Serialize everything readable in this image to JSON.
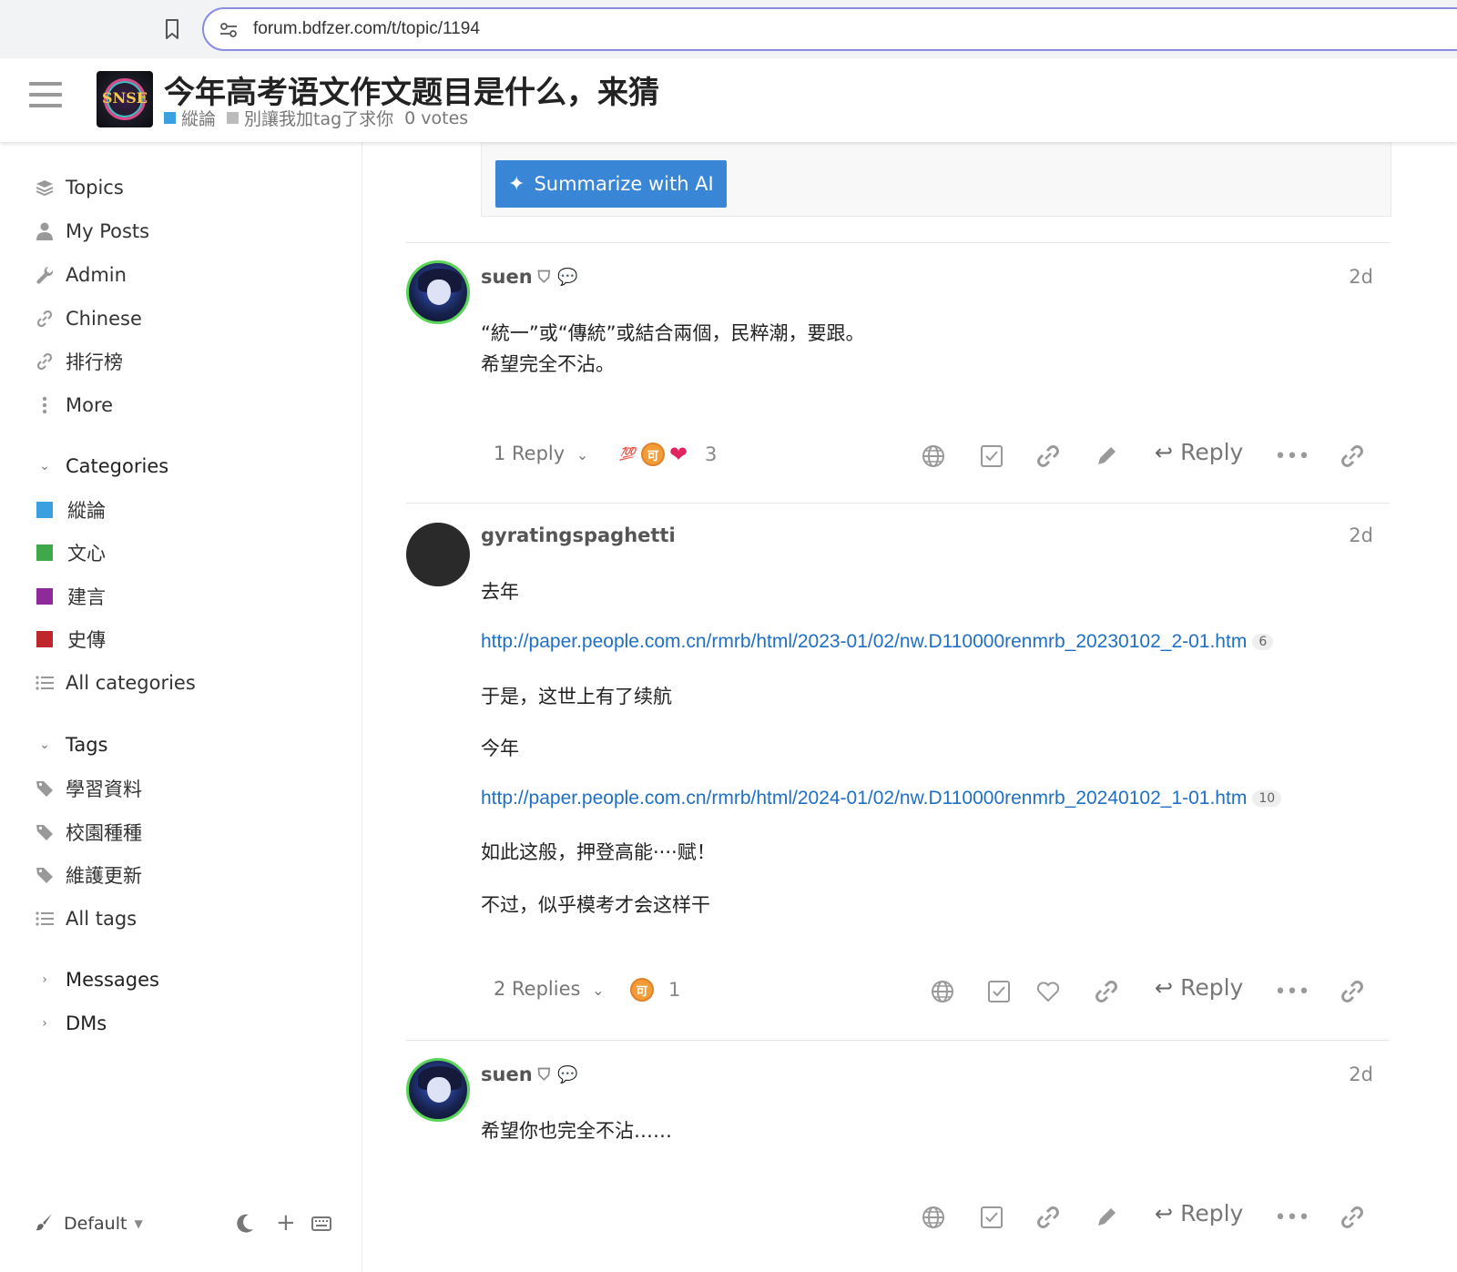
{
  "browser": {
    "url": "forum.bdfzer.com/t/topic/1194",
    "bookmark_icon": "bookmark-icon",
    "site_settings_icon": "tune-icon"
  },
  "header": {
    "logo_text": "SNSE",
    "title": "今年高考语文作文题目是什么，来猜",
    "category": "縱論",
    "category_color": "#3ba0e0",
    "tag": "別讓我加tag了求你",
    "votes": "0 votes"
  },
  "sidebar": {
    "nav": [
      {
        "label": "Topics",
        "icon": "layers-icon"
      },
      {
        "label": "My Posts",
        "icon": "user-icon"
      },
      {
        "label": "Admin",
        "icon": "wrench-icon"
      },
      {
        "label": "Chinese",
        "icon": "link-icon"
      },
      {
        "label": "排行榜",
        "icon": "link-icon"
      },
      {
        "label": "More",
        "icon": "ellipsis-vertical-icon"
      }
    ],
    "categories_title": "Categories",
    "categories": [
      {
        "label": "縱論",
        "color": "#3ba0e0"
      },
      {
        "label": "文心",
        "color": "#3fa84a"
      },
      {
        "label": "建言",
        "color": "#8e2a9a"
      },
      {
        "label": "史傳",
        "color": "#c0272d"
      }
    ],
    "all_categories": "All categories",
    "tags_title": "Tags",
    "tags": [
      "學習資料",
      "校園種種",
      "維護更新"
    ],
    "all_tags": "All tags",
    "messages": "Messages",
    "dms": "DMs",
    "footer": {
      "theme_label": "Default"
    }
  },
  "summary": {
    "button_label": "Summarize with AI"
  },
  "posts": [
    {
      "username": "suen",
      "date": "2d",
      "lines": [
        "“統一”或“傳統”或結合兩個，民粹潮，要跟。",
        "希望完全不沾。"
      ],
      "replies": "1 Reply",
      "reaction_count": "3",
      "reply_label": "Reply"
    },
    {
      "username": "gyratingspaghetti",
      "date": "2d",
      "p1": "去年",
      "link1": "http://paper.people.com.cn/rmrb/html/2023-01/02/nw.D110000renmrb_20230102_2-01.htm",
      "link1_clicks": "6",
      "p2": "于是，这世上有了续航",
      "p3": "今年",
      "link2": "http://paper.people.com.cn/rmrb/html/2024-01/02/nw.D110000renmrb_20240102_1-01.htm",
      "link2_clicks": "10",
      "p4": "如此这般，押登高能····赋！",
      "p5": "不过，似乎模考才会这样干",
      "replies": "2 Replies",
      "reaction_count": "1",
      "reply_label": "Reply"
    },
    {
      "username": "suen",
      "date": "2d",
      "lines": [
        "希望你也完全不沾……"
      ],
      "reply_label": "Reply"
    }
  ],
  "reactions": {
    "hundred": "💯",
    "coin": "可",
    "heart": "❤"
  }
}
